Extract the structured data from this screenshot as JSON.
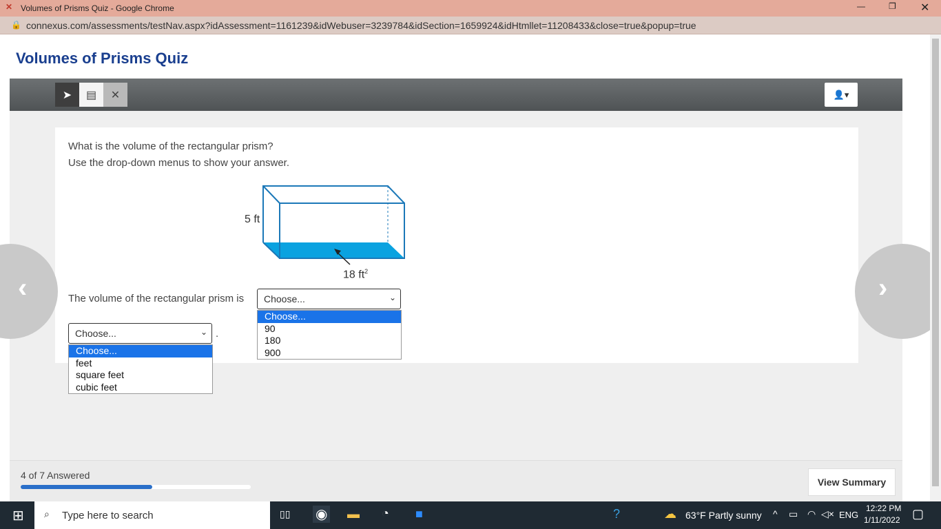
{
  "window": {
    "title": "Volumes of Prisms Quiz - Google Chrome",
    "url": "connexus.com/assessments/testNav.aspx?idAssessment=1161239&idWebuser=3239784&idSection=1659924&idHtmllet=11208433&close=true&popup=true"
  },
  "page": {
    "title": "Volumes of Prisms Quiz"
  },
  "question": {
    "line1": "What is the volume of the rectangular prism?",
    "line2": "Use the drop-down menus to show your answer.",
    "height_label": "5 ft",
    "base_label": "18 ft",
    "base_sup": "2",
    "sentence": "The volume of the rectangular prism is",
    "period": "."
  },
  "dropdown1": {
    "value": "Choose...",
    "options": [
      "Choose...",
      "90",
      "180",
      "900"
    ]
  },
  "dropdown2": {
    "value": "Choose...",
    "options": [
      "Choose...",
      "feet",
      "square feet",
      "cubic feet"
    ]
  },
  "footer": {
    "answered": "4 of 7 Answered",
    "progress": 0.571,
    "view_summary": "View Summary"
  },
  "taskbar": {
    "search": "Type here to search",
    "weather": "63°F  Partly sunny",
    "lang": "ENG",
    "time": "12:22 PM",
    "date": "1/11/2022"
  }
}
